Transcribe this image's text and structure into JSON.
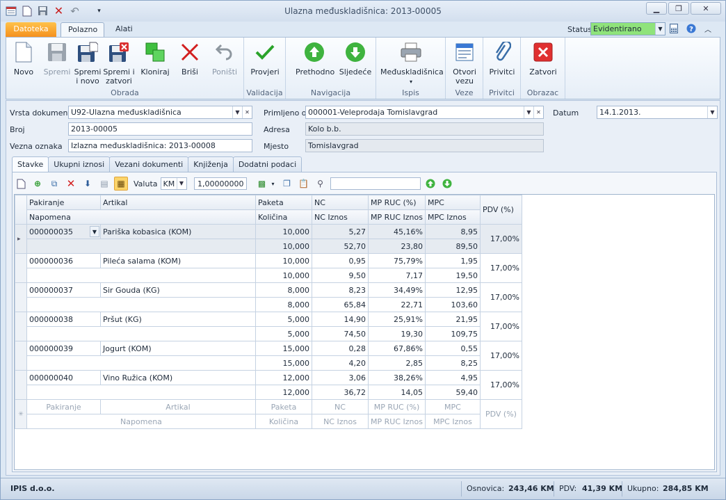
{
  "window": {
    "title": "Ulazna međuskladišnica: 2013-00005"
  },
  "ribbon_tabs": {
    "file": "Datoteka",
    "home": "Polazno",
    "tools": "Alati"
  },
  "status": {
    "label": "Status",
    "value": "Evidentirano"
  },
  "ribbon": {
    "groups": {
      "obrada": "Obrada",
      "validacija": "Validacija",
      "navigacija": "Navigacija",
      "ispis": "Ispis",
      "veze": "Veze",
      "privitci": "Privitci",
      "obrazac": "Obrazac"
    },
    "buttons": {
      "novo": "Novo",
      "spremi": "Spremi",
      "spremi_novo_1": "Spremi",
      "spremi_novo_2": "i novo",
      "spremi_zatvori_1": "Spremi i",
      "spremi_zatvori_2": "zatvori",
      "kloniraj": "Kloniraj",
      "brisi": "Briši",
      "ponisti": "Poništi",
      "provjeri": "Provjeri",
      "prethodno": "Prethodno",
      "sljedece": "Sljedeće",
      "meduskladisnica": "Međuskladišnica",
      "otvori_1": "Otvori",
      "otvori_2": "vezu",
      "privitci": "Privitci",
      "zatvori": "Zatvori"
    }
  },
  "form": {
    "vrsta_label": "Vrsta dokumenta",
    "vrsta_value": "U92-Ulazna međuskladišnica",
    "broj_label": "Broj",
    "broj_value": "2013-00005",
    "vezna_label": "Vezna oznaka",
    "vezna_value": "Izlazna međuskladišnica: 2013-00008",
    "primljeno_label": "Primljeno od",
    "primljeno_value": "000001-Veleprodaja Tomislavgrad",
    "adresa_label": "Adresa",
    "adresa_value": "Kolo b.b.",
    "mjesto_label": "Mjesto",
    "mjesto_value": "Tomislavgrad",
    "datum_label": "Datum",
    "datum_value": "14.1.2013."
  },
  "doc_tabs": [
    "Stavke",
    "Ukupni iznosi",
    "Vezani dokumenti",
    "Knjiženja",
    "Dodatni podaci"
  ],
  "toolbar": {
    "valuta_label": "Valuta",
    "valuta_value": "KM",
    "tecaj_value": "1,00000000"
  },
  "columns": {
    "pakiranje": "Pakiranje",
    "artikal": "Artikal",
    "paketa": "Paketa",
    "nc": "NC",
    "mp_ruc": "MP RUC (%)",
    "mpc": "MPC",
    "napomena": "Napomena",
    "kolicina": "Količina",
    "nc_iznos": "NC Iznos",
    "mp_ruc_iznos": "MP RUC Iznos",
    "mpc_iznos": "MPC Iznos",
    "pdv": "PDV (%)"
  },
  "rows": [
    {
      "pakiranje": "000000035",
      "artikal": "Pariška kobasica (KOM)",
      "paketa": "10,000",
      "nc": "5,27",
      "mp_ruc": "45,16%",
      "mpc": "8,95",
      "kolicina": "10,000",
      "nc_iznos": "52,70",
      "mp_ruc_iznos": "23,80",
      "mpc_iznos": "89,50",
      "pdv": "17,00%"
    },
    {
      "pakiranje": "000000036",
      "artikal": "Pileća salama (KOM)",
      "paketa": "10,000",
      "nc": "0,95",
      "mp_ruc": "75,79%",
      "mpc": "1,95",
      "kolicina": "10,000",
      "nc_iznos": "9,50",
      "mp_ruc_iznos": "7,17",
      "mpc_iznos": "19,50",
      "pdv": "17,00%"
    },
    {
      "pakiranje": "000000037",
      "artikal": "Sir Gouda (KG)",
      "paketa": "8,000",
      "nc": "8,23",
      "mp_ruc": "34,49%",
      "mpc": "12,95",
      "kolicina": "8,000",
      "nc_iznos": "65,84",
      "mp_ruc_iznos": "22,71",
      "mpc_iznos": "103,60",
      "pdv": "17,00%"
    },
    {
      "pakiranje": "000000038",
      "artikal": "Pršut (KG)",
      "paketa": "5,000",
      "nc": "14,90",
      "mp_ruc": "25,91%",
      "mpc": "21,95",
      "kolicina": "5,000",
      "nc_iznos": "74,50",
      "mp_ruc_iznos": "19,30",
      "mpc_iznos": "109,75",
      "pdv": "17,00%"
    },
    {
      "pakiranje": "000000039",
      "artikal": "Jogurt (KOM)",
      "paketa": "15,000",
      "nc": "0,28",
      "mp_ruc": "67,86%",
      "mpc": "0,55",
      "kolicina": "15,000",
      "nc_iznos": "4,20",
      "mp_ruc_iznos": "2,85",
      "mpc_iznos": "8,25",
      "pdv": "17,00%"
    },
    {
      "pakiranje": "000000040",
      "artikal": "Vino Ružica (KOM)",
      "paketa": "12,000",
      "nc": "3,06",
      "mp_ruc": "38,26%",
      "mpc": "4,95",
      "kolicina": "12,000",
      "nc_iznos": "36,72",
      "mp_ruc_iznos": "14,05",
      "mpc_iznos": "59,40",
      "pdv": "17,00%"
    }
  ],
  "statusbar": {
    "company": "IPIS d.o.o.",
    "osnovica_label": "Osnovica:",
    "osnovica_value": "243,46 KM",
    "pdv_label": "PDV:",
    "pdv_value": "41,39 KM",
    "ukupno_label": "Ukupno:",
    "ukupno_value": "284,85 KM"
  },
  "colors": {
    "accent": "#f5911f",
    "status_bg": "#8fe37b",
    "selected": "#fbd46a"
  }
}
